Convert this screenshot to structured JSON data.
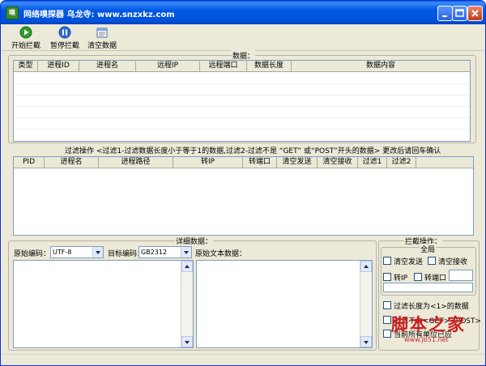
{
  "window": {
    "title": "网络嗅探器    乌龙寺: www.snzxkz.com",
    "app_icon_text": "嗅"
  },
  "toolbar": {
    "start_label": "开始拦截",
    "pause_label": "暂停拦截",
    "clear_label": "清空数据"
  },
  "data_section": {
    "label": "数据：",
    "columns": [
      "类型",
      "进程ID",
      "进程名",
      "远程IP",
      "远程端口",
      "数据长度",
      "数据内容"
    ]
  },
  "filter_section": {
    "label": "过滤操作 <过滤1-过滤数据长度小于等于1的数据,过滤2-过滤不是 “GET” 或“POST”开头的数据> 更改后请回车确认",
    "columns": [
      "PID",
      "进程名",
      "进程路径",
      "转IP",
      "转端口",
      "清空发送",
      "清空接收",
      "过滤1",
      "过滤2"
    ]
  },
  "detail_section": {
    "label": "详细数据：",
    "source_encoding_label": "原始编码：",
    "source_encoding_value": "UTF-8",
    "target_encoding_label": "目标编码：",
    "target_encoding_value": "GB2312",
    "raw_text_label": "原始文本数据："
  },
  "intercept_section": {
    "label": "拦截操作：",
    "global_label": "全局",
    "clear_send": "清空发送",
    "clear_receive": "清空接收",
    "redirect_ip": "转IP",
    "redirect_port": "转端口",
    "filter_length": "过滤长度为<1>的数据",
    "filter_not_get_post": "过滤不为<GET><POST>",
    "ok_button": "当前所有单位已应"
  },
  "watermark": {
    "text": "脚本之家",
    "url": "www.jb51.net"
  }
}
